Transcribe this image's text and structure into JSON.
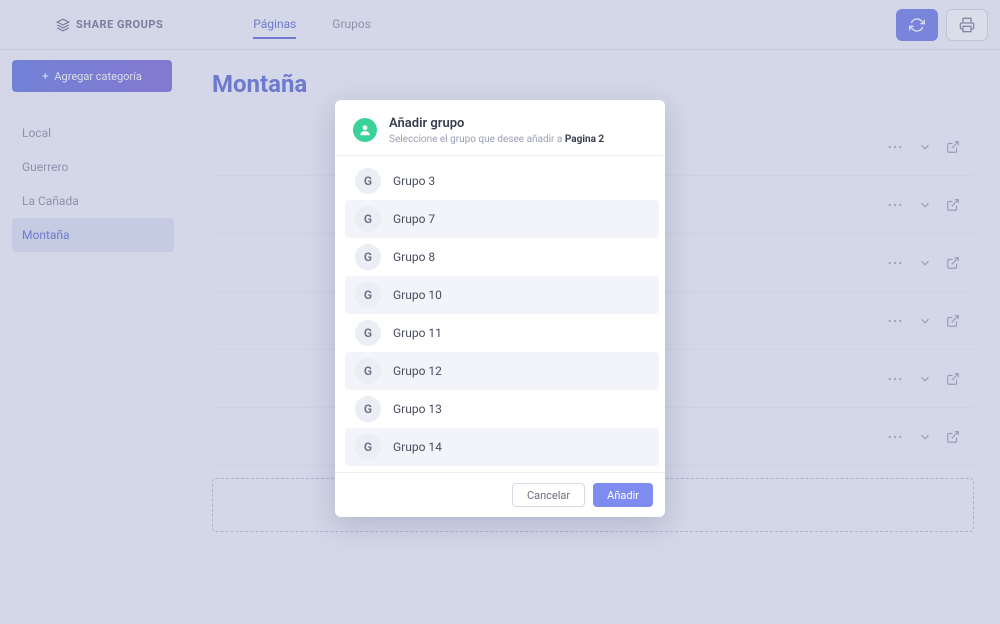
{
  "brand": "SHARE GROUPS",
  "tabs": [
    {
      "label": "Páginas",
      "active": true
    },
    {
      "label": "Grupos",
      "active": false
    }
  ],
  "sidebar": {
    "add_label": "Agregar categoría",
    "items": [
      {
        "label": "Local",
        "active": false
      },
      {
        "label": "Guerrero",
        "active": false
      },
      {
        "label": "La Cañada",
        "active": false
      },
      {
        "label": "Montaña",
        "active": true
      }
    ]
  },
  "page_title": "Montaña",
  "rows_count": 6,
  "modal": {
    "title": "Añadir grupo",
    "subtitle_prefix": "Seleccione el grupo que desee añadir a ",
    "subtitle_target": "Pagina 2",
    "items": [
      {
        "label": "Grupo 3"
      },
      {
        "label": "Grupo 7"
      },
      {
        "label": "Grupo 8"
      },
      {
        "label": "Grupo 10"
      },
      {
        "label": "Grupo 11"
      },
      {
        "label": "Grupo 12"
      },
      {
        "label": "Grupo 13"
      },
      {
        "label": "Grupo 14"
      }
    ],
    "item_avatar_letter": "G",
    "cancel_label": "Cancelar",
    "confirm_label": "Añadir"
  }
}
